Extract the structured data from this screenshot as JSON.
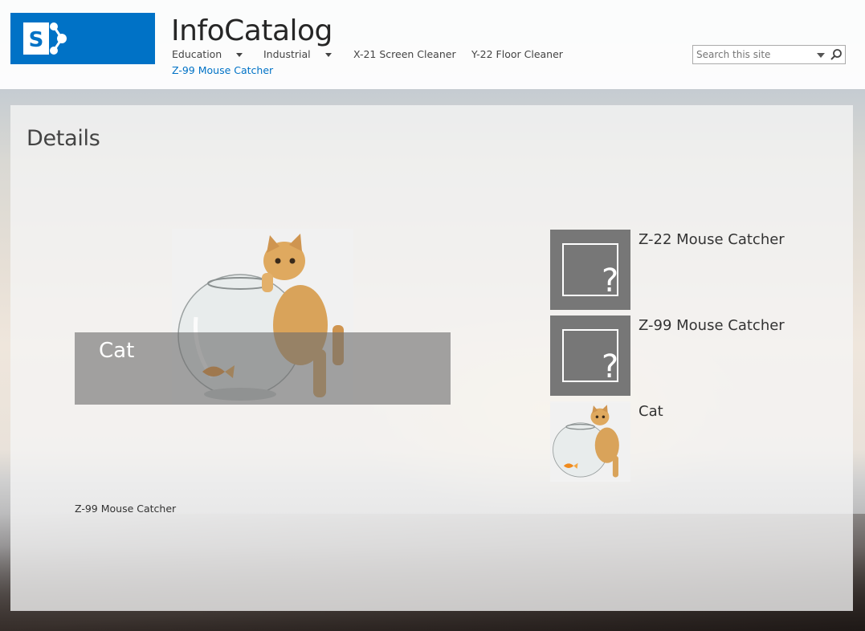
{
  "site": {
    "title": "InfoCatalog",
    "brand_color": "#0072c6"
  },
  "nav": {
    "items": [
      {
        "label": "Education",
        "has_dropdown": true
      },
      {
        "label": "Industrial",
        "has_dropdown": true
      },
      {
        "label": "X-21 Screen Cleaner",
        "has_dropdown": false
      },
      {
        "label": "Y-22 Floor Cleaner",
        "has_dropdown": false
      }
    ],
    "current": "Z-99 Mouse Catcher"
  },
  "search": {
    "placeholder": "Search this site",
    "icon": "magnifier-icon"
  },
  "page": {
    "title": "Details",
    "hero_caption": "Cat",
    "footer_text": "Z-99 Mouse Catcher"
  },
  "related": [
    {
      "title": "Z-22 Mouse Catcher",
      "thumb": "placeholder"
    },
    {
      "title": "Z-99 Mouse Catcher",
      "thumb": "placeholder"
    },
    {
      "title": "Cat",
      "thumb": "photo"
    }
  ],
  "placeholder_glyph": "?"
}
